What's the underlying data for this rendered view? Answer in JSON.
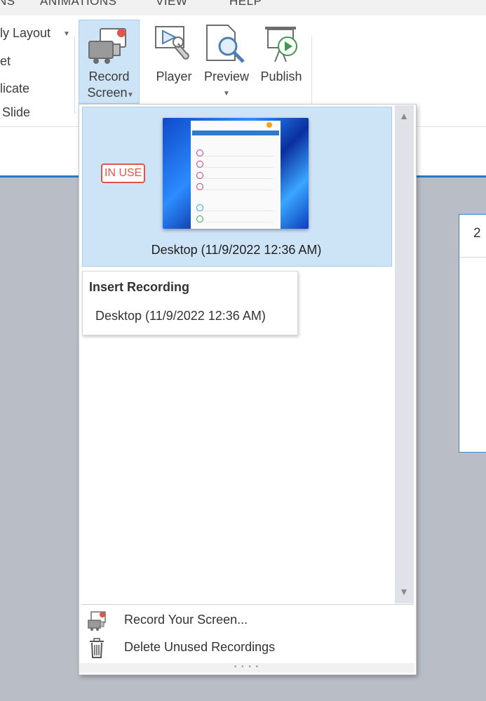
{
  "ribbon": {
    "tabs": [
      "NS",
      "ANIMATIONS",
      "VIEW",
      "HELP"
    ],
    "slide_group": [
      "ly Layout",
      "et",
      "licate",
      "Slide"
    ],
    "record_screen": {
      "line1": "Record",
      "line2": "Screen"
    },
    "player": "Player",
    "preview": "Preview",
    "publish": "Publish"
  },
  "slide": {
    "number": "2"
  },
  "dropdown": {
    "badge": "IN USE",
    "recording_caption": "Desktop (11/9/2022 12:36 AM)",
    "insert_popup": {
      "title": "Insert Recording",
      "item": "Desktop (11/9/2022 12:36 AM)"
    },
    "menu": {
      "record": "Record Your Screen...",
      "delete": "Delete Unused Recordings"
    }
  }
}
